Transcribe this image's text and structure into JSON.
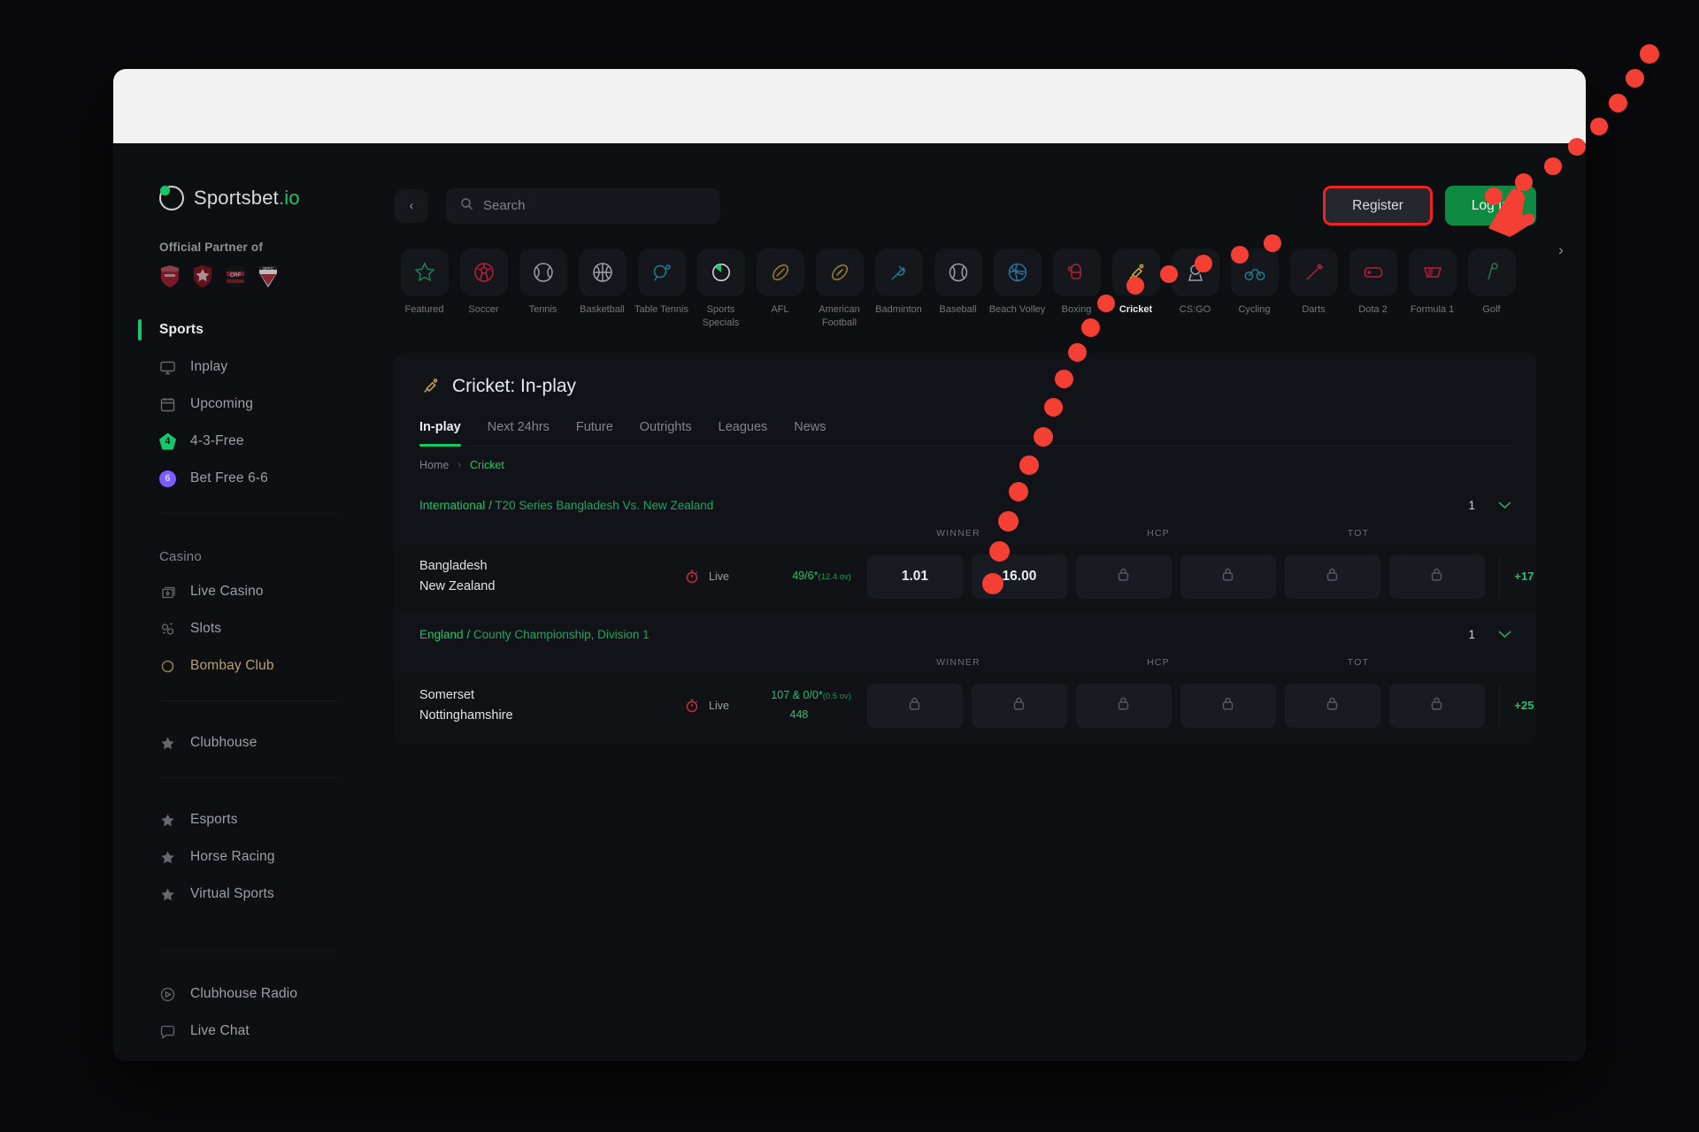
{
  "brand": {
    "name": "Sportsbet",
    "suffix": ".io"
  },
  "sidebar": {
    "partner_label": "Official Partner of",
    "sports_section": "Sports",
    "sports_items": [
      {
        "label": "Inplay",
        "icon": "monitor-icon"
      },
      {
        "label": "Upcoming",
        "icon": "calendar-icon"
      },
      {
        "label": "4-3-Free",
        "icon": "badge-4-icon"
      },
      {
        "label": "Bet Free 6-6",
        "icon": "badge-6-icon"
      }
    ],
    "casino_section": "Casino",
    "casino_items": [
      {
        "label": "Live Casino",
        "icon": "cards-icon"
      },
      {
        "label": "Slots",
        "icon": "slot-icon"
      },
      {
        "label": "Bombay Club",
        "icon": "diamond-icon"
      }
    ],
    "clubhouse_items": [
      {
        "label": "Clubhouse",
        "icon": "star-icon"
      }
    ],
    "extra_items": [
      {
        "label": "Esports",
        "icon": "star-icon"
      },
      {
        "label": "Horse Racing",
        "icon": "star-icon"
      },
      {
        "label": "Virtual Sports",
        "icon": "star-icon"
      }
    ],
    "footer_items": [
      {
        "label": "Clubhouse Radio",
        "icon": "radio-icon"
      },
      {
        "label": "Live Chat",
        "icon": "chat-icon"
      }
    ]
  },
  "topbar": {
    "back_icon": "chevron-left-icon",
    "search_placeholder": "Search",
    "register_label": "Register",
    "login_label": "Log In"
  },
  "sports_strip": {
    "next_icon": "chevron-right-icon",
    "items": [
      {
        "label": "Featured",
        "icon": "star-icon",
        "color": "#1f7a4d"
      },
      {
        "label": "Soccer",
        "icon": "soccer-ball-icon",
        "color": "#b5203a"
      },
      {
        "label": "Tennis",
        "icon": "tennis-ball-icon",
        "color": "#9aa0a8"
      },
      {
        "label": "Basketball",
        "icon": "basketball-icon",
        "color": "#9aa0a8"
      },
      {
        "label": "Table Tennis",
        "icon": "table-tennis-icon",
        "color": "#1d7f8f"
      },
      {
        "label": "Sports Specials",
        "icon": "sports-specials-icon",
        "color": "#cfd3d8"
      },
      {
        "label": "AFL",
        "icon": "afl-ball-icon",
        "color": "#9a8320"
      },
      {
        "label": "American Football",
        "icon": "american-football-icon",
        "color": "#9a8320"
      },
      {
        "label": "Badminton",
        "icon": "badminton-icon",
        "color": "#1d7f8f"
      },
      {
        "label": "Baseball",
        "icon": "baseball-icon",
        "color": "#9aa0a8"
      },
      {
        "label": "Beach Volley",
        "icon": "beach-volley-icon",
        "color": "#1d5f8f"
      },
      {
        "label": "Boxing",
        "icon": "boxing-glove-icon",
        "color": "#b5203a"
      },
      {
        "label": "Cricket",
        "icon": "cricket-bat-icon",
        "color": "#9a8320"
      },
      {
        "label": "CS:GO",
        "icon": "csgo-icon",
        "color": "#9aa0a8"
      },
      {
        "label": "Cycling",
        "icon": "cycling-icon",
        "color": "#1d7f8f"
      },
      {
        "label": "Darts",
        "icon": "dart-icon",
        "color": "#b5203a"
      },
      {
        "label": "Dota 2",
        "icon": "dota2-icon",
        "color": "#b5203a"
      },
      {
        "label": "Formula 1",
        "icon": "formula1-icon",
        "color": "#b5203a"
      },
      {
        "label": "Golf",
        "icon": "golf-icon",
        "color": "#1f7a4d"
      }
    ],
    "active": "Cricket"
  },
  "content": {
    "title": "Cricket: In-play",
    "title_icon": "cricket-bat-icon",
    "tabs": [
      {
        "label": "In-play",
        "active": true
      },
      {
        "label": "Next 24hrs",
        "active": false
      },
      {
        "label": "Future",
        "active": false
      },
      {
        "label": "Outrights",
        "active": false
      },
      {
        "label": "Leagues",
        "active": false
      },
      {
        "label": "News",
        "active": false
      }
    ],
    "breadcrumb": {
      "home": "Home",
      "separator": "›",
      "current": "Cricket"
    },
    "column_headers": {
      "winner": "WINNER",
      "hcp": "HCP",
      "tot": "TOT"
    },
    "leagues": [
      {
        "region": "International",
        "slash": "/",
        "name": "T20 Series Bangladesh Vs. New Zealand",
        "count": "1",
        "chevron": "chevron-down-icon",
        "match": {
          "home": "Bangladesh",
          "away": "New Zealand",
          "live_label": "Live",
          "live_icon": "stopwatch-icon",
          "score_line1": "49/6*",
          "score_overs": "(12.4 ov)",
          "score_line2": "",
          "odds": [
            "1.01",
            "16.00"
          ],
          "locked_count": 4,
          "lock_icon": "lock-icon",
          "more_label": "+17"
        }
      },
      {
        "region": "England",
        "slash": "/",
        "name": "County Championship, Division 1",
        "count": "1",
        "chevron": "chevron-down-icon",
        "match": {
          "home": "Somerset",
          "away": "Nottinghamshire",
          "live_label": "Live",
          "live_icon": "stopwatch-icon",
          "score_line1": "107 & 0/0*",
          "score_overs": "(0.5 ov)",
          "score_line2": "448",
          "odds": [],
          "locked_count": 6,
          "lock_icon": "lock-icon",
          "more_label": "+25"
        }
      }
    ]
  },
  "colors": {
    "accent_green": "#12c96a",
    "cursor_red": "#f43f35",
    "register_outline": "#f02222"
  }
}
